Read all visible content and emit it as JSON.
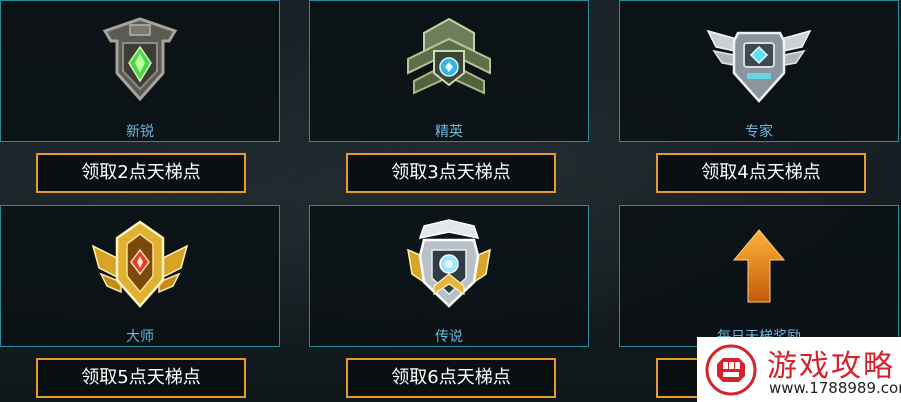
{
  "ranks": [
    {
      "name": "新锐",
      "reward_button": "领取2点天梯点",
      "emblem": "bronze-shield-emblem-icon",
      "gem_color": "#4fd44a"
    },
    {
      "name": "精英",
      "reward_button": "领取3点天梯点",
      "emblem": "green-chevron-emblem-icon",
      "gem_color": "#38b6e8"
    },
    {
      "name": "专家",
      "reward_button": "领取4点天梯点",
      "emblem": "silver-winged-emblem-icon",
      "gem_color": "#5fe0f0"
    },
    {
      "name": "大师",
      "reward_button": "领取5点天梯点",
      "emblem": "gold-winged-emblem-icon",
      "gem_color": "#e2401f"
    },
    {
      "name": "传说",
      "reward_button": "领取6点天梯点",
      "emblem": "gold-silver-crest-emblem-icon",
      "gem_color": "#9fe6ff"
    },
    {
      "name": "每日天梯奖励",
      "reward_button": "",
      "emblem": "orange-up-arrow-icon",
      "gem_color": "#f0941e"
    }
  ],
  "colors": {
    "card_border": "#2a8aa0",
    "rank_text": "#6ab7d9",
    "button_border": "#e89a2a",
    "watermark_red": "#d4232b"
  },
  "watermark": {
    "title": "游戏攻略",
    "url": "www.1788989.com",
    "logo": "gamepad-fist-logo-icon"
  }
}
